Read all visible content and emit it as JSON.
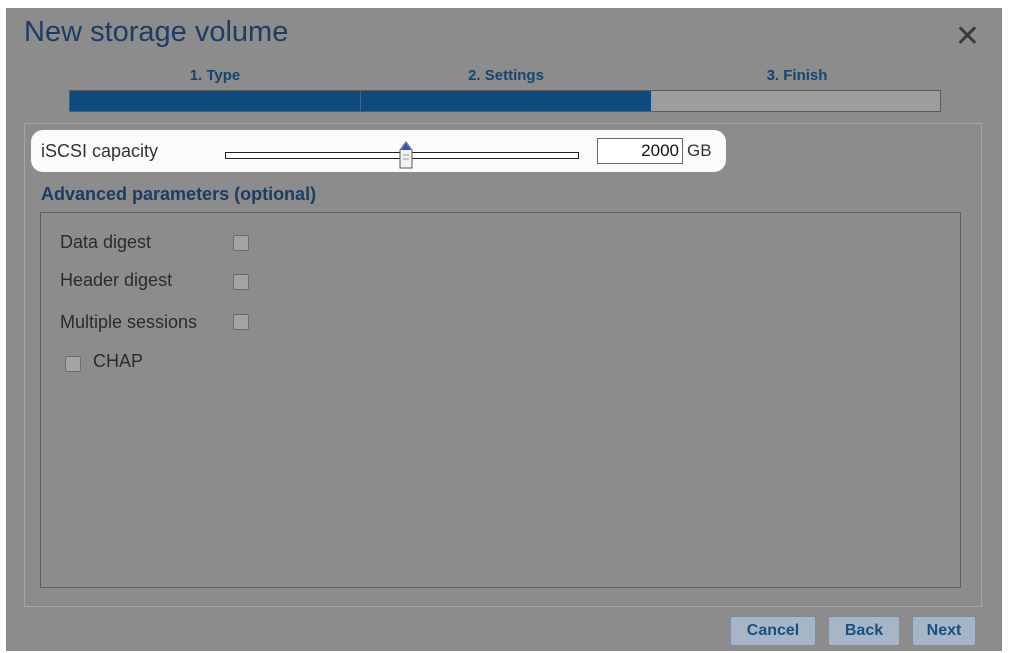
{
  "dialog": {
    "title": "New storage volume",
    "close_label": "✕"
  },
  "steps": [
    {
      "label": "1. Type",
      "state": "complete"
    },
    {
      "label": "2. Settings",
      "state": "current"
    },
    {
      "label": "3. Finish",
      "state": "pending"
    }
  ],
  "capacity": {
    "label": "iSCSI capacity",
    "value": "2000",
    "unit": "GB",
    "slider_fraction": 0.51
  },
  "advanced": {
    "title": "Advanced parameters (optional)",
    "options": [
      {
        "label": "Data digest",
        "checked": false
      },
      {
        "label": "Header digest",
        "checked": false
      },
      {
        "label": "Multiple sessions",
        "checked": false
      }
    ],
    "chap": {
      "label": "CHAP",
      "checked": false
    }
  },
  "buttons": {
    "cancel": "Cancel",
    "back": "Back",
    "next": "Next"
  },
  "colors": {
    "accent": "#0f4a7c",
    "title": "#1d3c63",
    "button_text": "#1a4f80"
  }
}
